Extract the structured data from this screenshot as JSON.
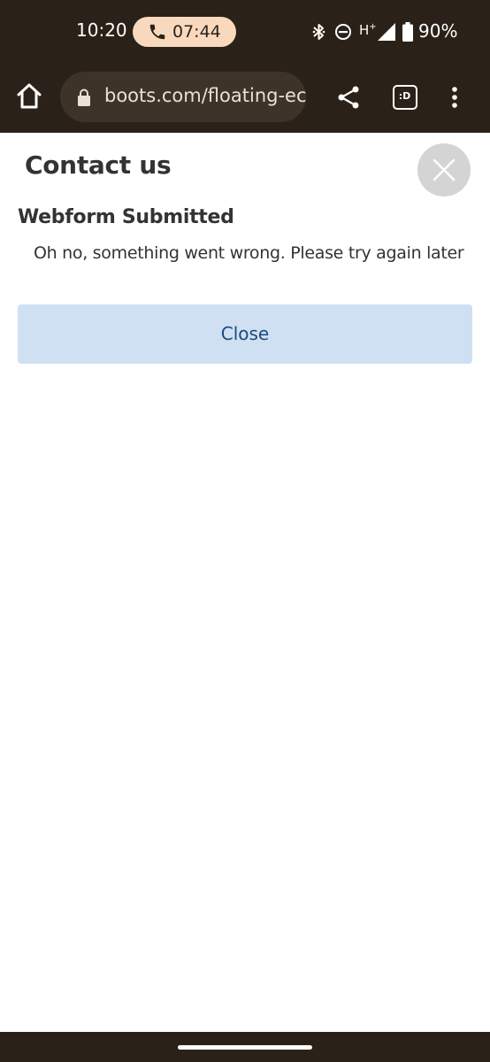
{
  "status_bar": {
    "time": "10:20",
    "call_timer": "07:44",
    "network": "H",
    "network_sup": "+",
    "battery": "90%",
    "icons": [
      "phone-icon",
      "bluetooth-icon",
      "do-not-disturb-icon",
      "signal-icon",
      "battery-icon"
    ]
  },
  "browser": {
    "url": "boots.com/floating-ec",
    "tab_count": ":D",
    "icons": [
      "home-icon",
      "lock-icon",
      "share-icon",
      "tabs-icon",
      "more-vert-icon"
    ]
  },
  "page": {
    "title": "Contact us",
    "heading": "Webform Submitted",
    "message": "Oh no, something went wrong. Please try again later",
    "close_button": "Close"
  },
  "colors": {
    "chrome_bg": "#2a2218",
    "url_bar_bg": "#3d3329",
    "call_pill_bg": "#f9d9bd",
    "button_bg": "#cfe0f3",
    "button_text": "#1e4a7a",
    "close_circle_bg": "#d4d4d4"
  }
}
